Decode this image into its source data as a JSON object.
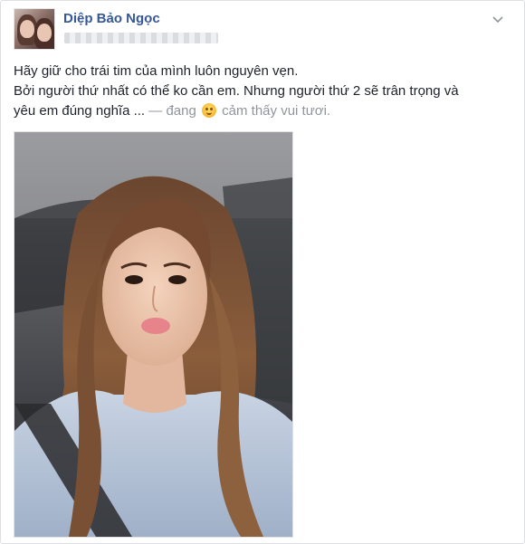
{
  "post": {
    "author_name": "Diệp Bảo Ngọc",
    "lines": [
      "Hãy giữ cho trái tim của mình luôn nguyên vẹn.",
      "Bởi người thứ nhất có thể ko cần em. Nhưng người thứ 2 sẽ trân trọng và"
    ],
    "line3_text": "yêu em đúng nghĩa ...",
    "feeling_separator": "— đang",
    "feeling_label": "cảm thấy vui tươi.",
    "feeling_icon": "happy-face-icon",
    "menu_icon": "chevron-down-icon"
  },
  "colors": {
    "author_link": "#365899",
    "body_text": "#1d2129",
    "secondary_text": "#90949c",
    "card_border": "#dddfe2"
  }
}
